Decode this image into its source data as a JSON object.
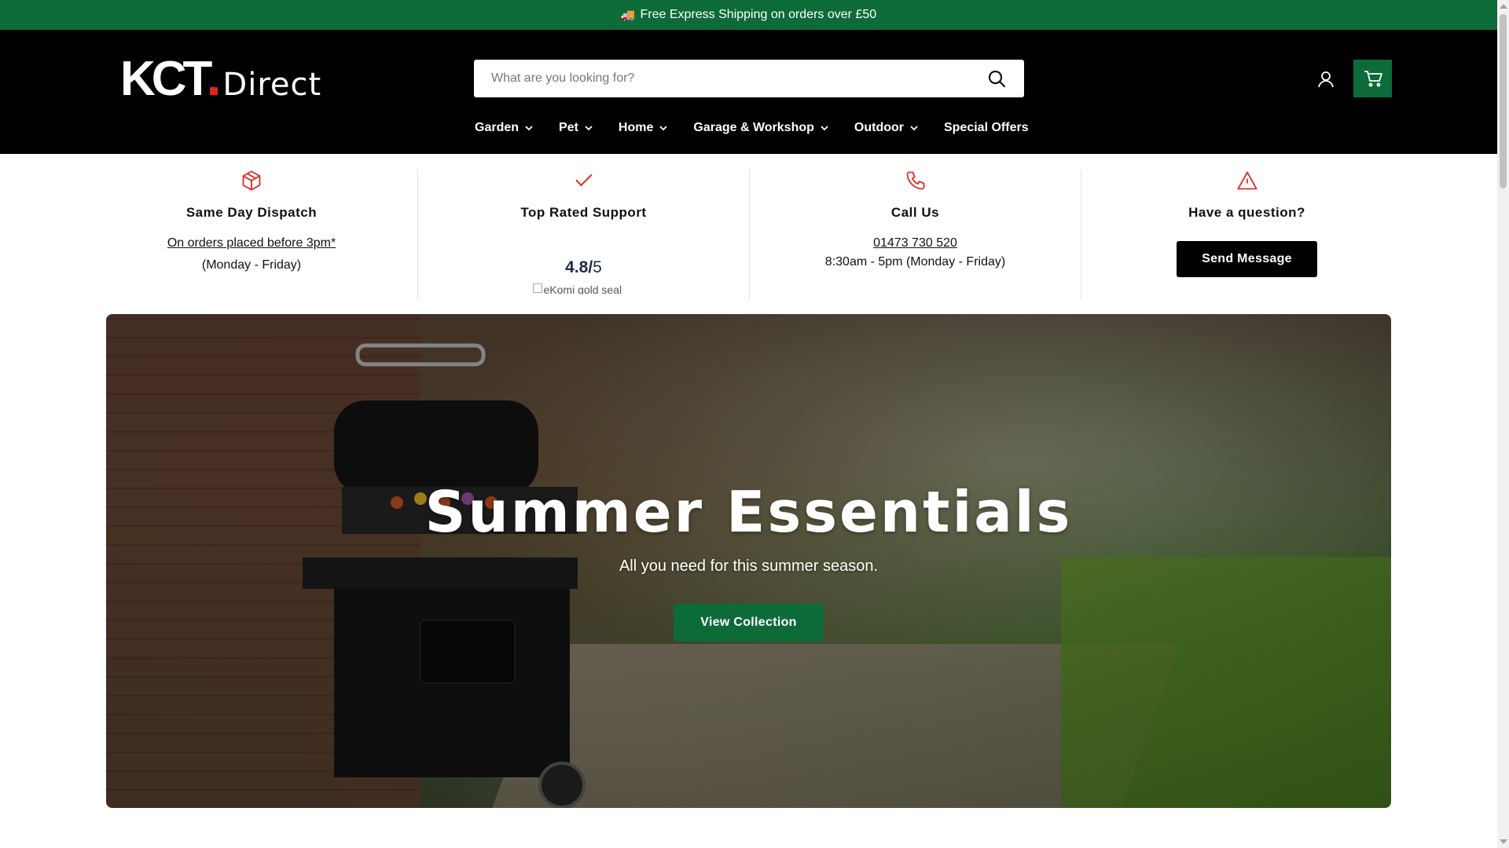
{
  "announcement": {
    "icon": "truck-icon",
    "emoji": "🚚",
    "text": "Free Express Shipping on orders over £50"
  },
  "header": {
    "logo": {
      "kct": "KCT",
      "direct": "Direct"
    },
    "search": {
      "placeholder": "What are you looking for?",
      "value": ""
    },
    "icons": {
      "search": "search-icon",
      "account": "user-icon",
      "cart": "cart-icon"
    },
    "nav": [
      {
        "label": "Garden",
        "has_dropdown": true
      },
      {
        "label": "Pet",
        "has_dropdown": true
      },
      {
        "label": "Home",
        "has_dropdown": true
      },
      {
        "label": "Garage & Workshop",
        "has_dropdown": true
      },
      {
        "label": "Outdoor",
        "has_dropdown": true
      },
      {
        "label": "Special Offers",
        "has_dropdown": false
      }
    ]
  },
  "usp": [
    {
      "icon": "box-icon",
      "title": "Same Day Dispatch",
      "link": "On orders placed before 3pm*",
      "sub": "(Monday - Friday)"
    },
    {
      "icon": "check-icon",
      "title": "Top Rated Support",
      "rating": "4.8/",
      "rating_den": "5",
      "img_alt": "eKomi gold seal"
    },
    {
      "icon": "phone-icon",
      "title": "Call Us",
      "link": "01473 730 520",
      "sub": "8:30am - 5pm (Monday - Friday)"
    },
    {
      "icon": "alert-triangle-icon",
      "title": "Have a question?",
      "button": "Send Message"
    }
  ],
  "hero": {
    "title": "Summer Essentials",
    "subtitle": "All you need for this summer season.",
    "button": "View Collection"
  },
  "colors": {
    "brand_green": "#0d6b3a",
    "accent_red": "#e2231a",
    "header_bg": "#000000"
  }
}
